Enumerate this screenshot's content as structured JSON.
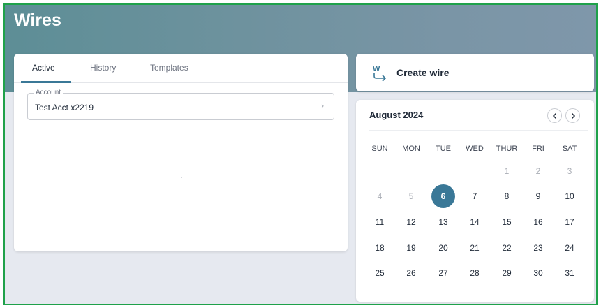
{
  "page": {
    "title": "Wires"
  },
  "tabs": [
    {
      "label": "Active",
      "active": true
    },
    {
      "label": "History",
      "active": false
    },
    {
      "label": "Templates",
      "active": false
    }
  ],
  "account": {
    "label": "Account",
    "value": "Test Acct x2219",
    "chevron": "›"
  },
  "create_wire": {
    "label": "Create wire",
    "icon": "wire-transfer-icon"
  },
  "calendar": {
    "month_label": "August 2024",
    "weekdays": [
      "SUN",
      "MON",
      "TUE",
      "WED",
      "THUR",
      "FRI",
      "SAT"
    ],
    "selected_day": "6",
    "weeks": [
      [
        "",
        "",
        "",
        "",
        "1",
        "2",
        "3"
      ],
      [
        "4",
        "5",
        "6",
        "7",
        "8",
        "9",
        "10"
      ],
      [
        "11",
        "12",
        "13",
        "14",
        "15",
        "16",
        "17"
      ],
      [
        "18",
        "19",
        "20",
        "21",
        "22",
        "23",
        "24"
      ],
      [
        "25",
        "26",
        "27",
        "28",
        "29",
        "30",
        "31"
      ]
    ],
    "muted_days": [
      "1",
      "2",
      "3",
      "4",
      "5"
    ]
  },
  "colors": {
    "accent": "#3a7897",
    "frame": "#1fa14a",
    "hero": "#6e929e"
  }
}
